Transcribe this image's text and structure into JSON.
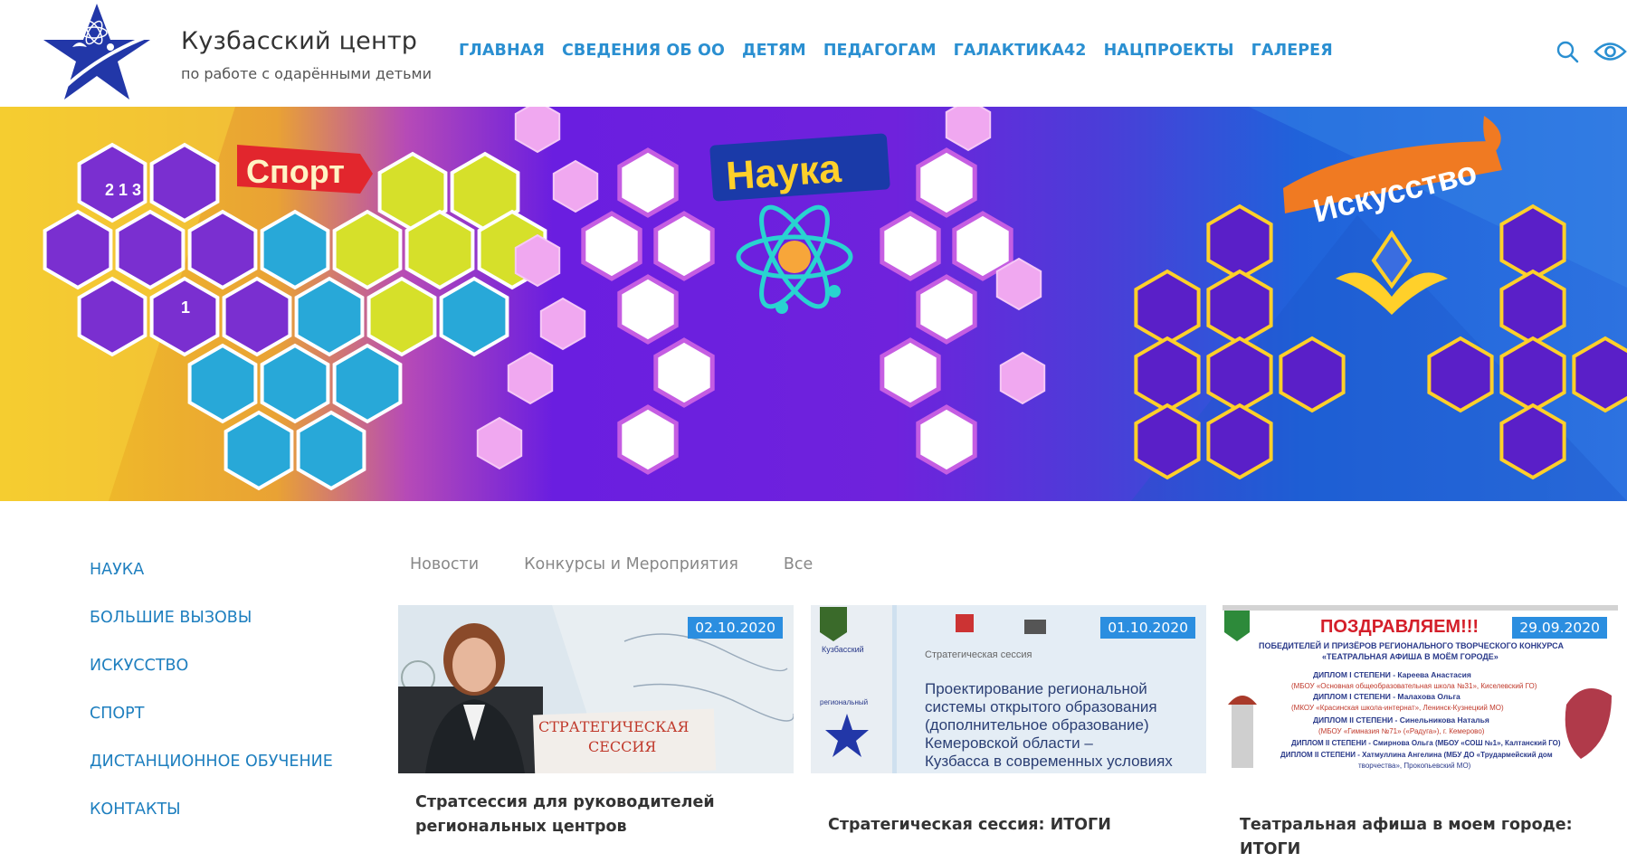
{
  "header": {
    "title": "Кузбасский центр",
    "subtitle": "по работе с одарёнными детьми",
    "logo_icon": "star-atom-logo"
  },
  "nav": [
    {
      "label": "ГЛАВНАЯ"
    },
    {
      "label": "СВЕДЕНИЯ ОБ ОО"
    },
    {
      "label": "ДЕТЯМ"
    },
    {
      "label": "ПЕДАГОГАМ"
    },
    {
      "label": "ГАЛАКТИКА42"
    },
    {
      "label": "НАЦПРОЕКТЫ"
    },
    {
      "label": "ГАЛЕРЕЯ"
    }
  ],
  "header_icons": [
    "search-icon",
    "eye-icon"
  ],
  "banner": {
    "sport_label": "Спорт",
    "science_label": "Наука",
    "art_label": "Искусство",
    "medal_text": "1",
    "podium_text": "2 1 3"
  },
  "sidebar": {
    "items": [
      {
        "label": "НАУКА"
      },
      {
        "label": "БОЛЬШИЕ ВЫЗОВЫ"
      },
      {
        "label": "ИСКУССТВО"
      },
      {
        "label": "СПОРТ"
      },
      {
        "label": "ДИСТАНЦИОННОЕ ОБУЧЕНИЕ"
      },
      {
        "label": "КОНТАКТЫ"
      }
    ]
  },
  "tabs": [
    {
      "label": "Новости"
    },
    {
      "label": "Конкурсы и Мероприятия"
    },
    {
      "label": "Все"
    }
  ],
  "cards": [
    {
      "date": "02.10.2020",
      "title": "Стратсессия для руководителей региональных центров",
      "image_text": [
        "СТРАТЕГИЧЕСКАЯ",
        "СЕССИЯ"
      ]
    },
    {
      "date": "01.10.2020",
      "title": "Стратегическая сессия: ИТОГИ",
      "image_text": [
        "Стратегическая сессия",
        "Проектирование региональной",
        "системы открытого образования",
        "(дополнительное образование)",
        "Кемеровской области –",
        "Кузбасса в современных условиях",
        "Кузбасский",
        "региональный"
      ]
    },
    {
      "date": "29.09.2020",
      "title": "Театральная афиша в моем городе: ИТОГИ",
      "image_text": [
        "ПОЗДРАВЛЯЕМ!!!",
        "ПОБЕДИТЕЛЕЙ И ПРИЗЁРОВ РЕГИОНАЛЬНОГО ТВОРЧЕСКОГО КОНКУРСА",
        "«ТЕАТРАЛЬНАЯ АФИША В МОЁМ ГОРОДЕ»",
        "ДИПЛОМ I СТЕПЕНИ - Кареева Анастасия",
        "(МБОУ «Основная общеобразовательная школа №31», Киселевский ГО)",
        "ДИПЛОМ I СТЕПЕНИ - Малахова Ольга",
        "(МКОУ «Красинская школа-интернат», Ленинск-Кузнецкий МО)",
        "ДИПЛОМ II СТЕПЕНИ - Синельникова Наталья",
        "(МБОУ «Гимназия №71» («Радуга»), г. Кемерово)",
        "ДИПЛОМ II СТЕПЕНИ - Смирнова Ольга (МБОУ «СОШ №1», Калтанский ГО)",
        "ДИПЛОМ II СТЕПЕНИ - Хатмуллина Ангелина (МБУ ДО «Трудармейский дом",
        "творчества», Прокопьевский МО)"
      ]
    }
  ],
  "colors": {
    "nav": "#2a8fd1",
    "sidebar": "#1e7fbf",
    "date_badge": "#2b8ee0",
    "banner_yellow": "#f3c322",
    "banner_purple": "#6e1ed6",
    "banner_blue": "#1e67d9"
  }
}
